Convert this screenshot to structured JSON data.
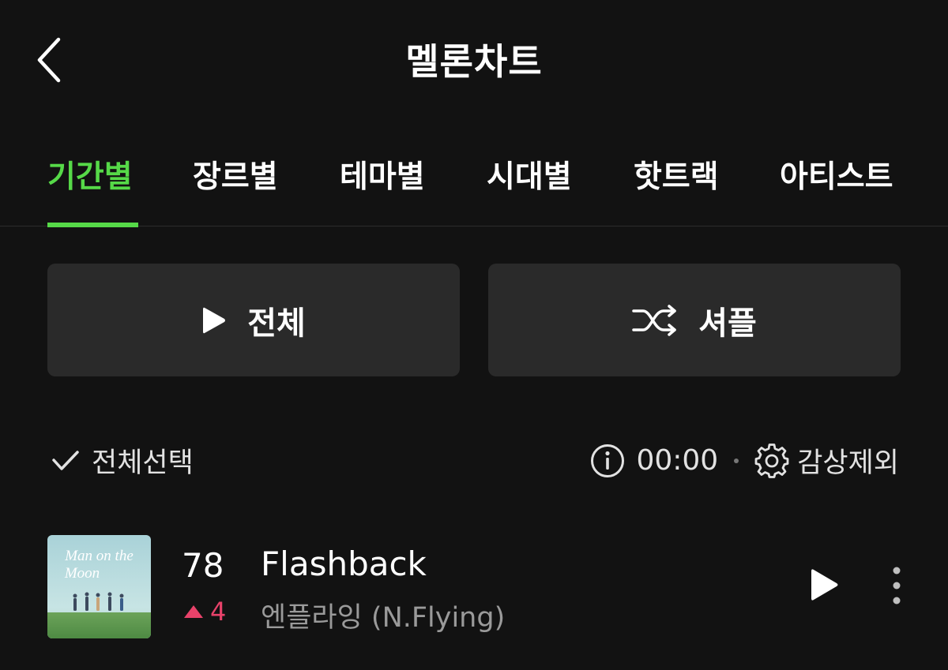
{
  "header": {
    "title": "멜론차트",
    "back_icon": "chevron-left-icon"
  },
  "tabs": [
    {
      "label": "기간별",
      "active": true
    },
    {
      "label": "장르별",
      "active": false
    },
    {
      "label": "테마별",
      "active": false
    },
    {
      "label": "시대별",
      "active": false
    },
    {
      "label": "핫트랙",
      "active": false
    },
    {
      "label": "아티스트",
      "active": false
    }
  ],
  "actions": {
    "play_all_label": "전체",
    "shuffle_label": "셔플"
  },
  "options": {
    "select_all_label": "전체선택",
    "timer": "00:00",
    "exclude_label": "감상제외"
  },
  "songs": [
    {
      "rank": "78",
      "rank_change": "4",
      "rank_direction": "up",
      "title": "Flashback",
      "artist": "엔플라잉 (N.Flying)",
      "album_art_text": "Man on the Moon"
    }
  ],
  "colors": {
    "background": "#121212",
    "accent_green": "#56d948",
    "rank_up": "#e8426a",
    "button_bg": "#2a2a2a"
  }
}
